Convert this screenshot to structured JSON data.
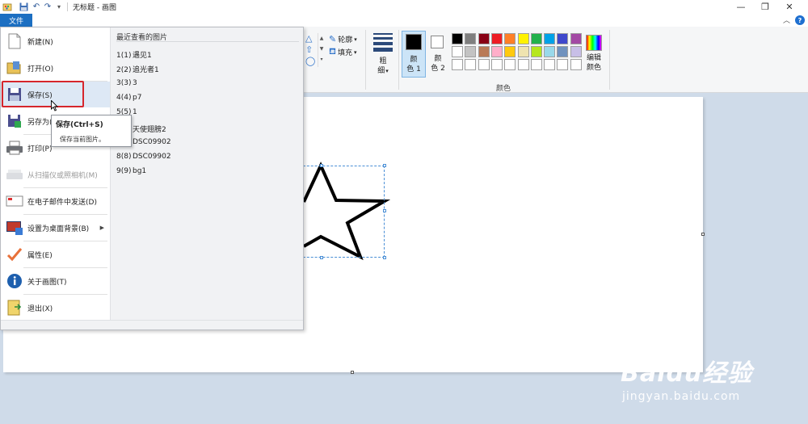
{
  "window": {
    "title": "无标题 - 画图",
    "controls": {
      "minimize": "—",
      "restore": "❐",
      "close": "✕"
    }
  },
  "quick_access": {
    "customize": "▾"
  },
  "tabs": {
    "file": "文件",
    "help": "?"
  },
  "ribbon": {
    "outline_label": "轮廓",
    "fill_label": "填充",
    "size_label": "粗\n细",
    "size_text_1": "粗",
    "size_text_2": "细",
    "color1_line1": "颜",
    "color1_line2": "色 1",
    "color2_line1": "颜",
    "color2_line2": "色 2",
    "edit_colors_line1": "编辑",
    "edit_colors_line2": "颜色",
    "colors_group_label": "颜色",
    "color1_value": "#000000",
    "color2_value": "#ffffff",
    "palette_row1": [
      "#000000",
      "#7f7f7f",
      "#880015",
      "#ed1c24",
      "#ff7f27",
      "#fff200",
      "#22b14c",
      "#00a2e8",
      "#3f48cc",
      "#a349a4"
    ],
    "palette_row2": [
      "#ffffff",
      "#c3c3c3",
      "#b97a57",
      "#ffaec9",
      "#ffc90e",
      "#efe4b0",
      "#b5e61d",
      "#99d9ea",
      "#7092be",
      "#c8bfe7"
    ]
  },
  "file_menu": {
    "items": [
      {
        "label": "新建(N)",
        "icon": "new-file-icon"
      },
      {
        "label": "打开(O)",
        "icon": "open-folder-icon"
      },
      {
        "label": "保存(S)",
        "icon": "save-icon"
      },
      {
        "label": "另存为(A)",
        "icon": "save-as-icon"
      },
      {
        "label": "打印(P)",
        "icon": "print-icon"
      },
      {
        "label": "从扫描仪或照相机(M)",
        "icon": "scanner-icon"
      },
      {
        "label": "在电子邮件中发送(D)",
        "icon": "email-icon"
      },
      {
        "label": "设置为桌面背景(B)",
        "icon": "desktop-background-icon"
      },
      {
        "label": "属性(E)",
        "icon": "properties-check-icon"
      },
      {
        "label": "关于画图(T)",
        "icon": "info-icon"
      },
      {
        "label": "退出(X)",
        "icon": "exit-icon"
      }
    ],
    "recent_title": "最近查看的图片",
    "recent": [
      {
        "num": "1(1)",
        "name": "遇见1"
      },
      {
        "num": "2(2)",
        "name": "追光者1"
      },
      {
        "num": "3(3)",
        "name": "3"
      },
      {
        "num": "4(4)",
        "name": "p7"
      },
      {
        "num": "5(5)",
        "name": "1"
      },
      {
        "num": "6(6)",
        "name": "天使翅膀2"
      },
      {
        "num": "7(7)",
        "name": "DSC09902"
      },
      {
        "num": "8(8)",
        "name": "DSC09902"
      },
      {
        "num": "9(9)",
        "name": "bg1"
      }
    ]
  },
  "tooltip": {
    "title": "保存(Ctrl+S)",
    "description": "保存当前图片。"
  },
  "watermark": {
    "logo_text": "Baidu经验",
    "url": "jingyan.baidu.com"
  }
}
